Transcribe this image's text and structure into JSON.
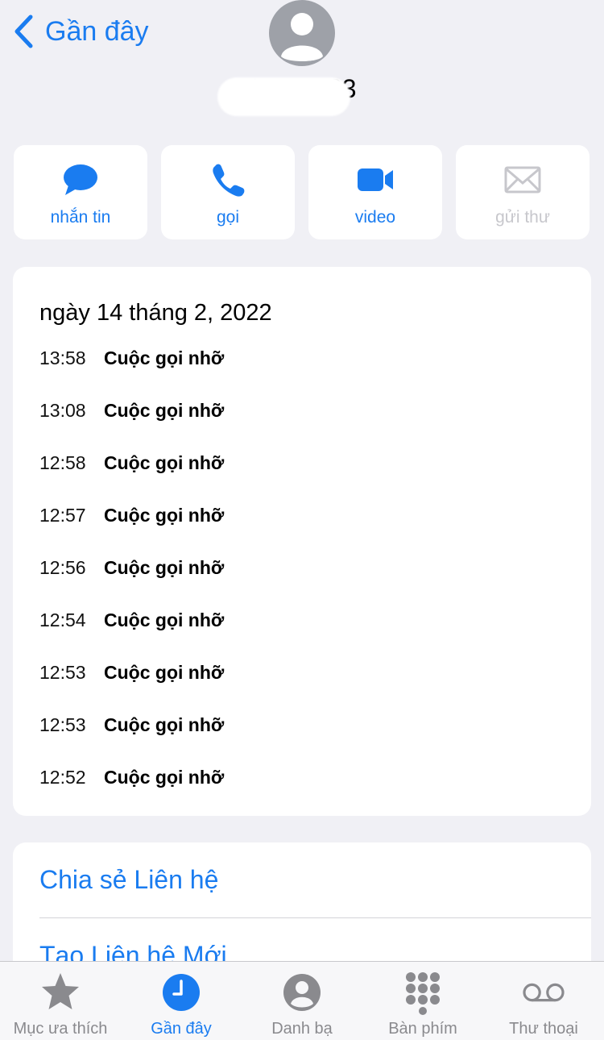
{
  "header": {
    "back_label": "Gần đây",
    "phone_number": "0·· ··· ·23"
  },
  "actions": [
    {
      "label": "nhắn tin",
      "icon": "message-icon",
      "enabled": true
    },
    {
      "label": "gọi",
      "icon": "phone-icon",
      "enabled": true
    },
    {
      "label": "video",
      "icon": "video-icon",
      "enabled": true
    },
    {
      "label": "gửi thư",
      "icon": "mail-icon",
      "enabled": false
    }
  ],
  "history": {
    "date": "ngày 14 tháng 2, 2022",
    "calls": [
      {
        "time": "13:58",
        "type": "Cuộc gọi nhỡ"
      },
      {
        "time": "13:08",
        "type": "Cuộc gọi nhỡ"
      },
      {
        "time": "12:58",
        "type": "Cuộc gọi nhỡ"
      },
      {
        "time": "12:57",
        "type": "Cuộc gọi nhỡ"
      },
      {
        "time": "12:56",
        "type": "Cuộc gọi nhỡ"
      },
      {
        "time": "12:54",
        "type": "Cuộc gọi nhỡ"
      },
      {
        "time": "12:53",
        "type": "Cuộc gọi nhỡ"
      },
      {
        "time": "12:53",
        "type": "Cuộc gọi nhỡ"
      },
      {
        "time": "12:52",
        "type": "Cuộc gọi nhỡ"
      }
    ]
  },
  "contact_actions": {
    "share": "Chia sẻ Liên hệ",
    "create_new": "Tạo Liên hệ Mới"
  },
  "tabbar": [
    {
      "label": "Mục ưa thích",
      "icon": "star-icon",
      "active": false
    },
    {
      "label": "Gần đây",
      "icon": "clock-icon",
      "active": true
    },
    {
      "label": "Danh bạ",
      "icon": "contacts-icon",
      "active": false
    },
    {
      "label": "Bàn phím",
      "icon": "keypad-icon",
      "active": false
    },
    {
      "label": "Thư thoại",
      "icon": "voicemail-icon",
      "active": false
    }
  ],
  "colors": {
    "accent": "#1a7cf0",
    "background": "#f0f0f5",
    "disabled": "#c7c7cc",
    "tab_inactive": "#8a8a8e"
  }
}
